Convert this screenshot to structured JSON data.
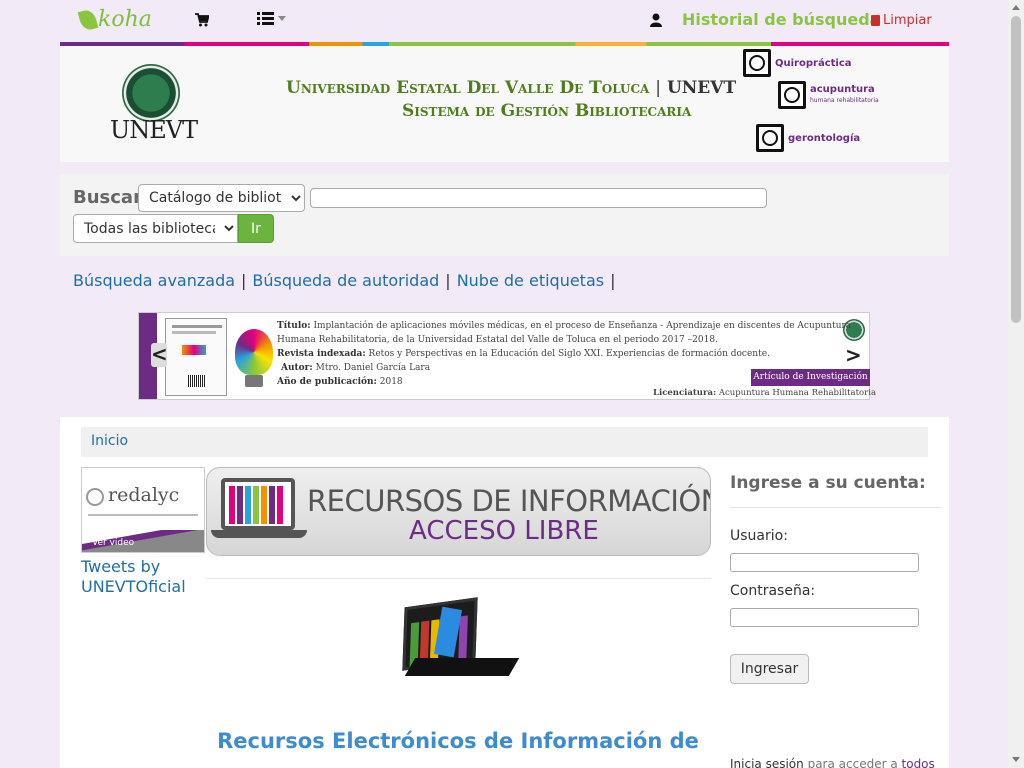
{
  "topnav": {
    "logo_text": "koha",
    "history_label": "Historial de búsqueda",
    "clear_label": "Limpiar"
  },
  "header": {
    "university_name": "Universidad Estatal Del Valle De Toluca",
    "separator": "|",
    "abbr": "UNEVT",
    "system_name": "Sistema de Gestión Bibliotecaria",
    "seal_text": "UNEVT",
    "specialties": [
      {
        "label": "Quiropráctica",
        "sub": ""
      },
      {
        "label": "acupuntura",
        "sub": "humana rehabilitatoria"
      },
      {
        "label": "gerontología",
        "sub": ""
      }
    ]
  },
  "search": {
    "label": "Buscar",
    "catalog_selected": "Catálogo de bibliotec",
    "query_value": "",
    "library_selected": "Todas las bibliotecas",
    "go_label": "Ir"
  },
  "more_links": {
    "advanced": "Búsqueda avanzada",
    "authority": "Búsqueda de autoridad",
    "tags": "Nube de etiquetas",
    "separator": "|"
  },
  "carousel": {
    "prev": "<",
    "next": ">",
    "title_label": "Título:",
    "title_text": "Implantación de aplicaciones móviles médicas, en el proceso de Enseñanza - Aprendizaje en discentes de Acupuntura",
    "title_text2": "Humana Rehabilitatoria, de la Universidad Estatal del Valle de Toluca en el periodo 2017 –2018.",
    "journal_label": "Revista indexada:",
    "journal_text": "Retos y Perspectivas en la Educación del Siglo XXI. Experiencias de formación docente.",
    "author_label": "Autor:",
    "author_text": "Mtro. Daniel García Lara",
    "year_label": "Año de publicación:",
    "year_text": "2018",
    "tag": "Artículo de Investigación",
    "lic_label": "Licenciatura:",
    "lic_text": "Acupuntura Humana Rehabilitatoria"
  },
  "main": {
    "breadcrumb_home": "Inicio",
    "redalyc_name": "redalyc",
    "redalyc_video": "Ver video",
    "tweets": "Tweets by UNEVTOficial",
    "recursos_line1": "RECURSOS DE INFORMACIÓN",
    "recursos_line2": "ACCESO LIBRE",
    "heading": "Recursos Electrónicos de Información de"
  },
  "login": {
    "title": "Ingrese a su cuenta:",
    "user_label": "Usuario:",
    "user_value": "",
    "pass_label": "Contraseña:",
    "pass_value": "",
    "submit": "Ingresar",
    "note_pre": "Inicia sesión",
    "note_mid": "para acceder a",
    "note_link": "todos"
  },
  "colors": {
    "koha_green": "#8bc53f",
    "link_blue": "#1e6fa8",
    "purple": "#6d2c84",
    "danger": "#c9302c",
    "go_button": "#6cb33f"
  },
  "icons": [
    "cart-icon",
    "list-icon",
    "user-icon",
    "trash-icon",
    "chevron-left-icon",
    "chevron-right-icon"
  ]
}
